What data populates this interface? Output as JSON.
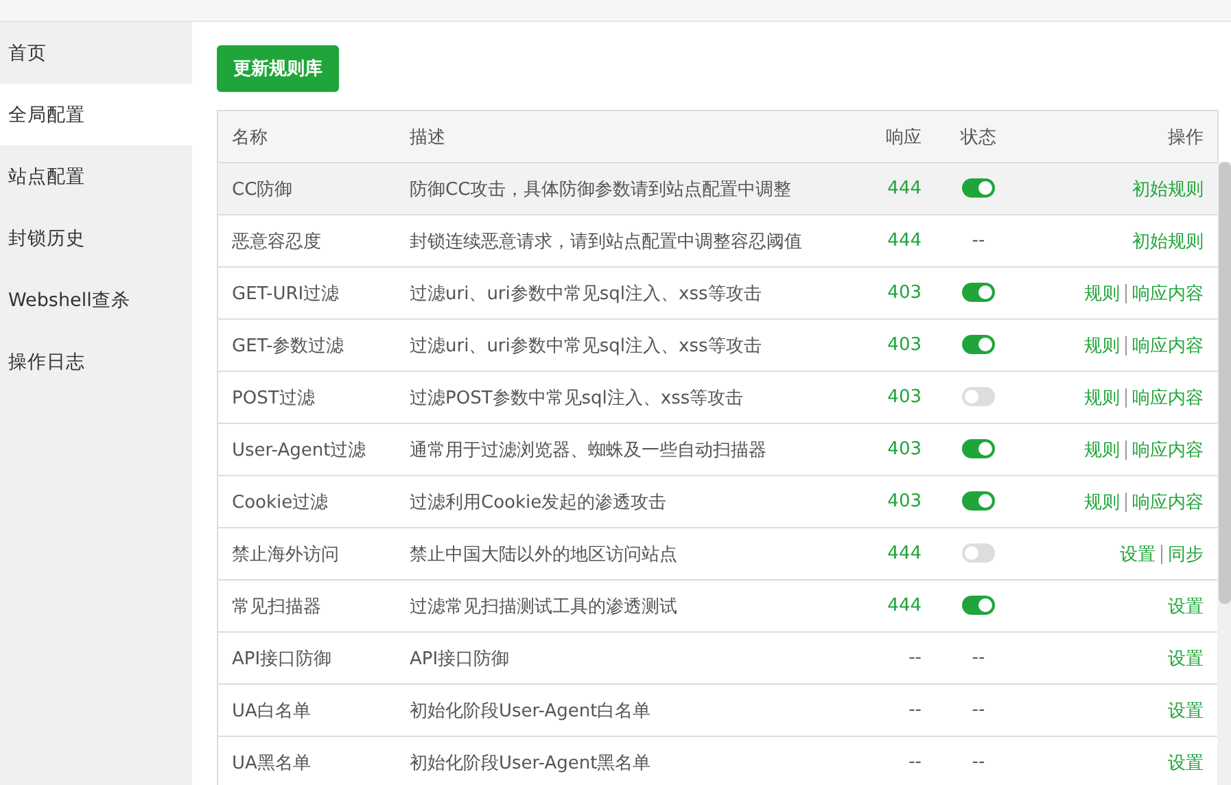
{
  "sidebar": {
    "items": [
      {
        "label": "首页",
        "selected": false
      },
      {
        "label": "全局配置",
        "selected": true
      },
      {
        "label": "站点配置",
        "selected": false
      },
      {
        "label": "封锁历史",
        "selected": false
      },
      {
        "label": "Webshell查杀",
        "selected": false
      },
      {
        "label": "操作日志",
        "selected": false
      }
    ]
  },
  "update_button": "更新规则库",
  "table": {
    "columns": [
      "名称",
      "描述",
      "响应",
      "状态",
      "操作"
    ],
    "rows": [
      {
        "name": "CC防御",
        "description": "防御CC攻击，具体防御参数请到站点配置中调整",
        "response": {
          "kind": "code",
          "text": "444"
        },
        "status": {
          "kind": "toggle",
          "on": true
        },
        "actions": [
          "初始规则"
        ],
        "highlighted": true
      },
      {
        "name": "恶意容忍度",
        "description": "封锁连续恶意请求，请到站点配置中调整容忍阈值",
        "response": {
          "kind": "code",
          "text": "444"
        },
        "status": {
          "kind": "text",
          "text": "--"
        },
        "actions": [
          "初始规则"
        ],
        "highlighted": false
      },
      {
        "name": "GET-URI过滤",
        "description": "过滤uri、uri参数中常见sql注入、xss等攻击",
        "response": {
          "kind": "code",
          "text": "403"
        },
        "status": {
          "kind": "toggle",
          "on": true
        },
        "actions": [
          "规则",
          "响应内容"
        ],
        "highlighted": false
      },
      {
        "name": "GET-参数过滤",
        "description": "过滤uri、uri参数中常见sql注入、xss等攻击",
        "response": {
          "kind": "code",
          "text": "403"
        },
        "status": {
          "kind": "toggle",
          "on": true
        },
        "actions": [
          "规则",
          "响应内容"
        ],
        "highlighted": false
      },
      {
        "name": "POST过滤",
        "description": "过滤POST参数中常见sql注入、xss等攻击",
        "response": {
          "kind": "code",
          "text": "403"
        },
        "status": {
          "kind": "toggle",
          "on": false
        },
        "actions": [
          "规则",
          "响应内容"
        ],
        "highlighted": false
      },
      {
        "name": "User-Agent过滤",
        "description": "通常用于过滤浏览器、蜘蛛及一些自动扫描器",
        "response": {
          "kind": "code",
          "text": "403"
        },
        "status": {
          "kind": "toggle",
          "on": true
        },
        "actions": [
          "规则",
          "响应内容"
        ],
        "highlighted": false
      },
      {
        "name": "Cookie过滤",
        "description": "过滤利用Cookie发起的渗透攻击",
        "response": {
          "kind": "code",
          "text": "403"
        },
        "status": {
          "kind": "toggle",
          "on": true
        },
        "actions": [
          "规则",
          "响应内容"
        ],
        "highlighted": false
      },
      {
        "name": "禁止海外访问",
        "description": "禁止中国大陆以外的地区访问站点",
        "response": {
          "kind": "code",
          "text": "444"
        },
        "status": {
          "kind": "toggle",
          "on": false
        },
        "actions": [
          "设置",
          "同步"
        ],
        "highlighted": false
      },
      {
        "name": "常见扫描器",
        "description": "过滤常见扫描测试工具的渗透测试",
        "response": {
          "kind": "code",
          "text": "444"
        },
        "status": {
          "kind": "toggle",
          "on": true
        },
        "actions": [
          "设置"
        ],
        "highlighted": false
      },
      {
        "name": "API接口防御",
        "description": "API接口防御",
        "response": {
          "kind": "text",
          "text": "--"
        },
        "status": {
          "kind": "text",
          "text": "--"
        },
        "actions": [
          "设置"
        ],
        "highlighted": false
      },
      {
        "name": "UA白名单",
        "description": "初始化阶段User-Agent白名单",
        "response": {
          "kind": "text",
          "text": "--"
        },
        "status": {
          "kind": "text",
          "text": "--"
        },
        "actions": [
          "设置"
        ],
        "highlighted": false
      },
      {
        "name": "UA黑名单",
        "description": "初始化阶段User-Agent黑名单",
        "response": {
          "kind": "text",
          "text": "--"
        },
        "status": {
          "kind": "text",
          "text": "--"
        },
        "actions": [
          "设置"
        ],
        "highlighted": false
      }
    ]
  }
}
